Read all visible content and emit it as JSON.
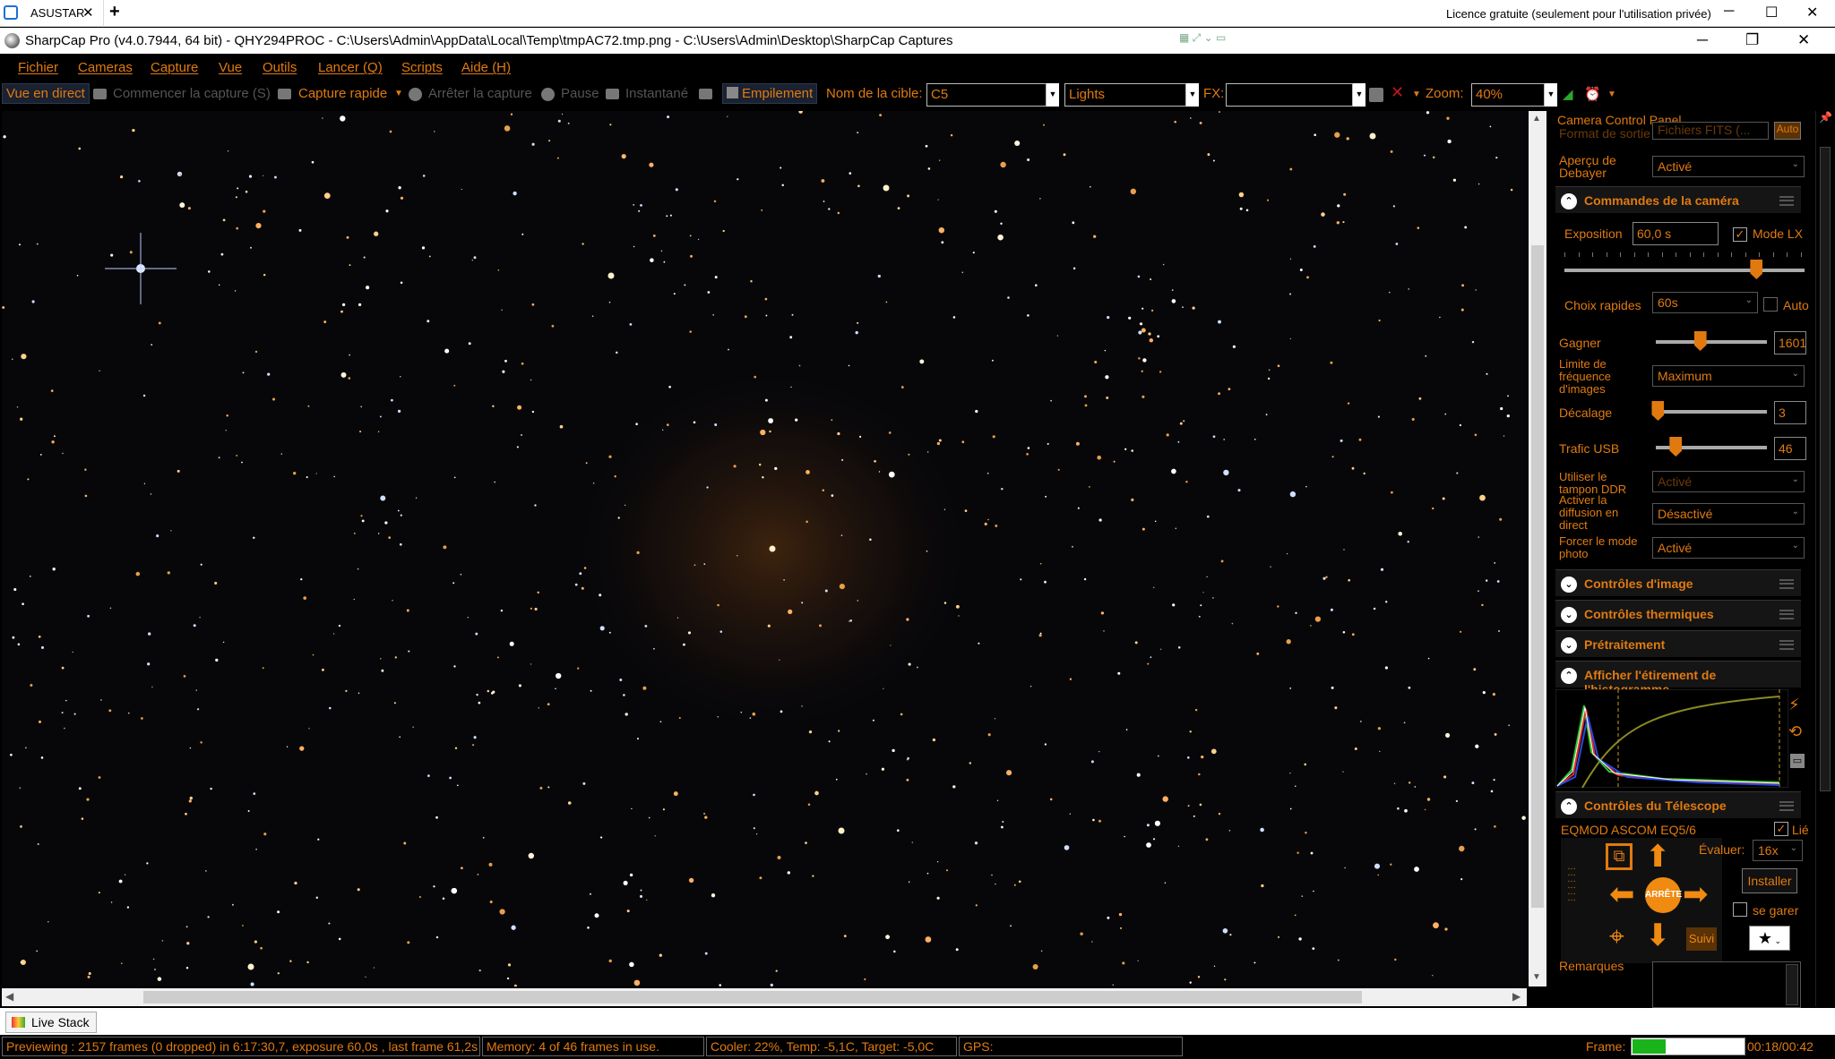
{
  "remote": {
    "tab_label": "ASUSTAR",
    "close_glyph": "✕",
    "new_tab_glyph": "+",
    "license": "Licence gratuite (seulement pour l'utilisation privée)",
    "min_glyph": "─",
    "max_glyph": "☐",
    "close_win_glyph": "✕"
  },
  "app": {
    "title": "SharpCap Pro (v4.0.7944, 64 bit) - QHY294PROC - C:\\Users\\Admin\\AppData\\Local\\Temp\\tmpAC72.tmp.png - C:\\Users\\Admin\\Desktop\\SharpCap Captures",
    "min_glyph": "─",
    "restore_glyph": "❐",
    "close_glyph": "✕"
  },
  "menu": [
    "Fichier",
    "Cameras",
    "Capture",
    "Vue",
    "Outils",
    "Lancer (Q)",
    "Scripts",
    "Aide (H)"
  ],
  "toolbar": {
    "live_view": "Vue en direct",
    "start_capture": "Commencer la capture (S)",
    "quick_capture": "Capture rapide",
    "stop_capture": "Arrêter la capture",
    "pause": "Pause",
    "snapshot": "Instantané",
    "stacking": "Empilement",
    "target_label": "Nom de la cible:",
    "target_value": "C5",
    "frame_type": "Lights",
    "fx_label": "FX:",
    "fx_value": "",
    "zoom_label": "Zoom:",
    "zoom_value": "40%"
  },
  "panel": {
    "title": "Camera Control Panel",
    "output_format_label": "Format de sortie",
    "output_format_value": "Fichiers FITS (...",
    "auto_label": "Auto",
    "debayer_label": "Aperçu de Debayer",
    "debayer_value": "Activé",
    "section_camera": "Commandes de la caméra",
    "exposure_label": "Exposition",
    "exposure_value": "60,0 s",
    "lx_mode_label": "Mode LX",
    "lx_mode_checked": "✓",
    "exposure_level": 0.8,
    "quick_choice_label": "Choix rapides",
    "quick_choice_value": "60s",
    "quick_auto_label": "Auto",
    "gain_label": "Gagner",
    "gain_value": "1601",
    "gain_level": 0.4,
    "frame_rate_label": "Limite de fréquence d'images",
    "frame_rate_value": "Maximum",
    "offset_label": "Décalage",
    "offset_value": "3",
    "offset_level": 0.02,
    "usb_label": "Trafic USB",
    "usb_value": "46",
    "usb_level": 0.18,
    "ddr_label": "Utiliser le tampon DDR",
    "ddr_value": "Activé",
    "live_stream_label": "Activer la diffusion en direct",
    "live_stream_value": "Désactivé",
    "photo_mode_label": "Forcer le mode photo",
    "photo_mode_value": "Activé",
    "section_image": "Contrôles d'image",
    "section_thermal": "Contrôles thermiques",
    "section_preproc": "Prétraitement",
    "section_histogram": "Afficher l'étirement de l'histogramme",
    "section_telescope": "Contrôles du Télescope",
    "scope_name": "EQMOD ASCOM EQ5/6",
    "linked_label": "Lié",
    "linked_checked": "✓",
    "rate_label": "Évaluer:",
    "rate_value": "16x",
    "install_label": "Installer",
    "stop_label": "ARRÊTE",
    "park_label": "se garer",
    "tracking_label": "Suivi",
    "star_glyph": "★",
    "notes_label": "Remarques"
  },
  "livestack_tab": "Live Stack",
  "status": {
    "preview": "Previewing : 2157 frames (0 dropped) in 6:17:30,7, exposure 60,0s , last frame 61,2s",
    "memory": "Memory: 4 of 46 frames in use.",
    "cooler": "Cooler: 22%, Temp: -5,1C, Target: -5,0C",
    "gps": "GPS:",
    "frame_label": "Frame:",
    "frame_progress": 0.3,
    "frame_time": "00:18/00:42"
  },
  "colors": {
    "accent": "#e07a10",
    "background": "#000000",
    "progress": "#1ab31a"
  }
}
